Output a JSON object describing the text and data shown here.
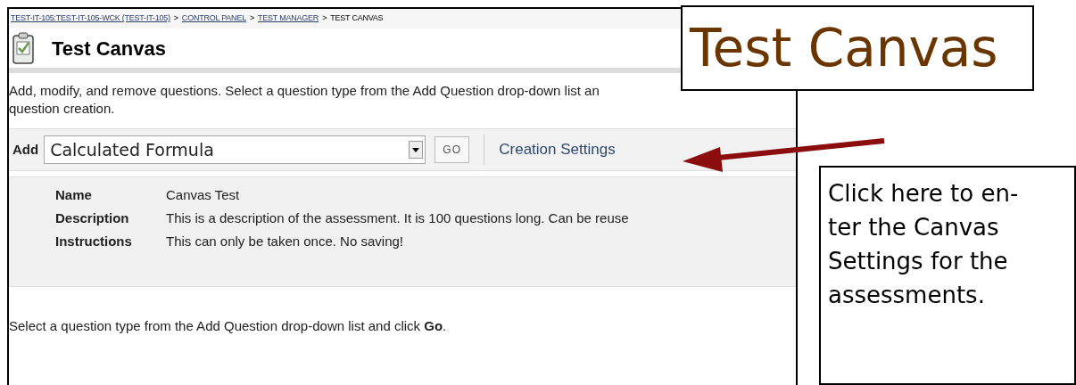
{
  "breadcrumb": [
    {
      "label": "TEST-IT-105:TEST-IT-105-WCK (TEST-IT-105)",
      "link": true
    },
    {
      "label": ">",
      "link": false
    },
    {
      "label": "CONTROL PANEL",
      "link": true
    },
    {
      "label": ">",
      "link": false
    },
    {
      "label": "TEST MANAGER",
      "link": true
    },
    {
      "label": ">",
      "link": false
    },
    {
      "label": "TEST CANVAS",
      "link": false
    }
  ],
  "page_title": "Test Canvas",
  "intro": [
    "Add, modify, and remove questions. Select a question type from the Add Question drop-down list an",
    "question creation."
  ],
  "toolbar": {
    "add_label": "Add",
    "question_type": "Calculated Formula",
    "go_button": "GO",
    "settings_link": "Creation Settings"
  },
  "details": [
    {
      "label": "Name",
      "value": "Canvas Test"
    },
    {
      "label": "Description",
      "value": "This is a description of the assessment.  It is 100 questions long.  Can be reuse"
    },
    {
      "label": "Instructions",
      "value": "This can only be taken once.  No saving!"
    }
  ],
  "footer_text": "Select a question type from the Add Question drop-down list and click **Go**.",
  "title_callout": "Test Canvas",
  "note_callout": [
    "Click here to en-",
    "ter the Canvas",
    "Settings for the",
    "assessments."
  ]
}
